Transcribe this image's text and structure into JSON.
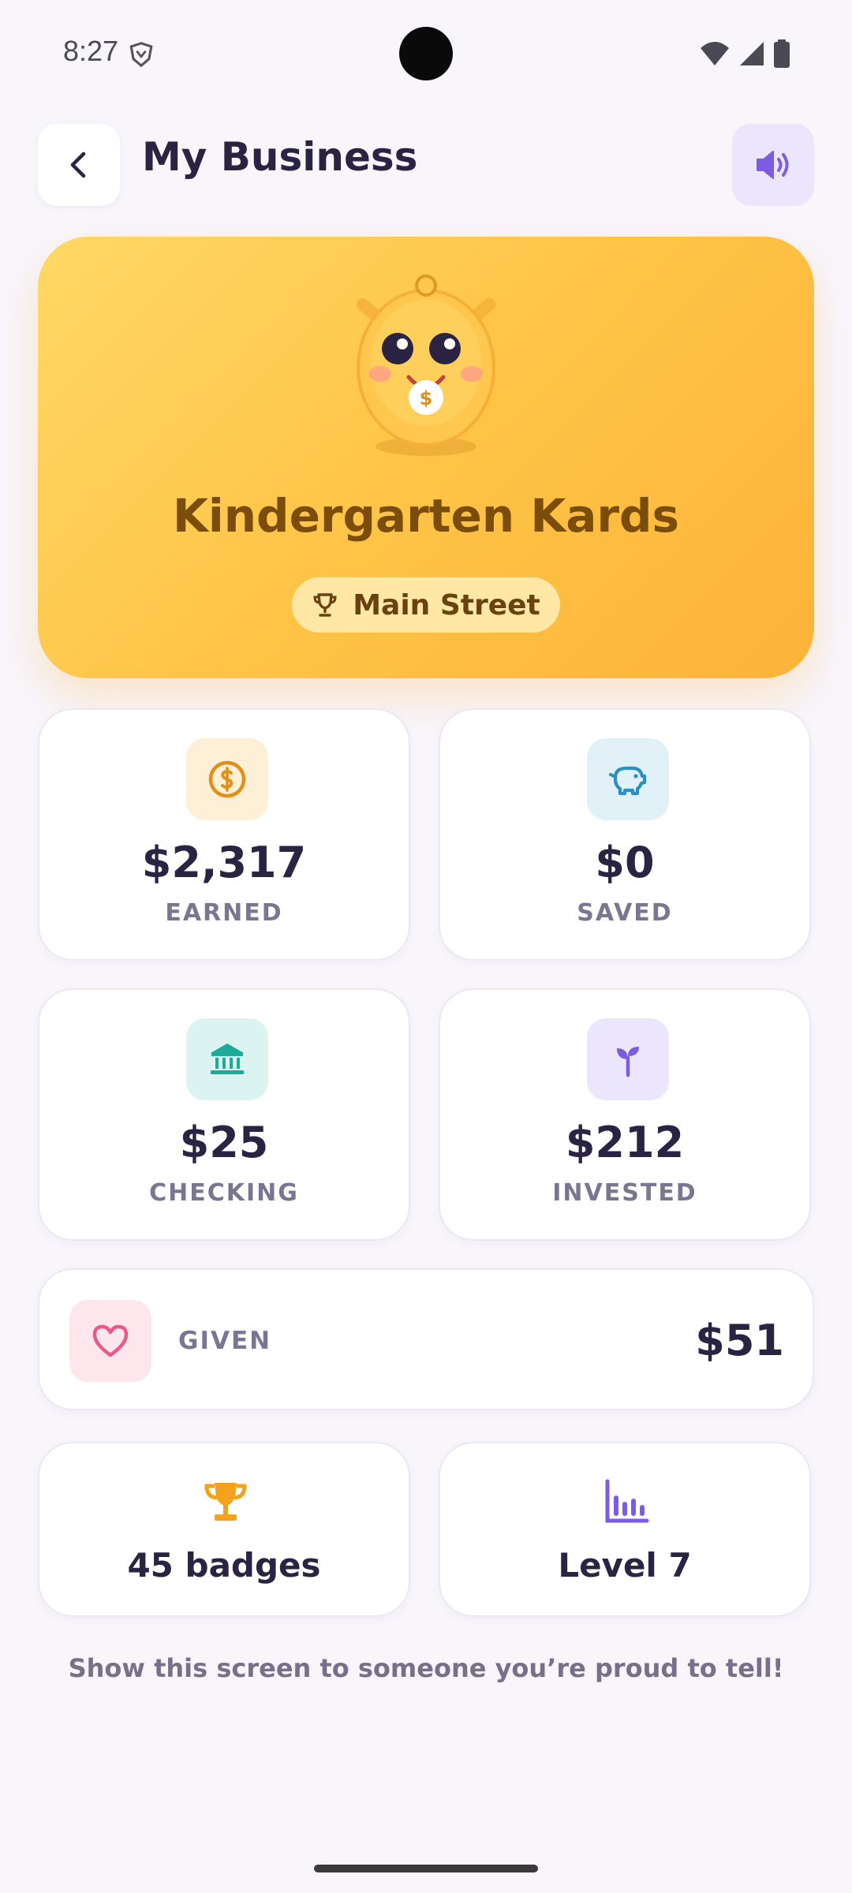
{
  "status_bar": {
    "time": "8:27"
  },
  "header": {
    "title": "My Business",
    "back_icon": "chevron-left-icon",
    "sound_icon": "speaker-icon"
  },
  "hero": {
    "business_name": "Kindergarten Kards",
    "street": "Main Street",
    "mascot_coin_symbol": "$",
    "colors": {
      "gradient_start": "#ffd865",
      "gradient_end": "#fcb338",
      "name_color": "#7a4d0a"
    }
  },
  "stats": [
    {
      "value": "$2,317",
      "label": "EARNED",
      "icon": "coin-icon",
      "icon_bg": "#fdf0d6",
      "icon_color": "#e0901a"
    },
    {
      "value": "$0",
      "label": "SAVED",
      "icon": "piggy-bank-icon",
      "icon_bg": "#e2f0f7",
      "icon_color": "#2b8fc2"
    },
    {
      "value": "$25",
      "label": "CHECKING",
      "icon": "bank-icon",
      "icon_bg": "#dcf4f1",
      "icon_color": "#1bab98"
    },
    {
      "value": "$212",
      "label": "INVESTED",
      "icon": "sprout-icon",
      "icon_bg": "#ece6fd",
      "icon_color": "#7c5ce0"
    }
  ],
  "given": {
    "label": "GIVEN",
    "value": "$51",
    "icon": "heart-icon",
    "icon_color": "#e95b87"
  },
  "badges": {
    "text": "45 badges",
    "icon": "trophy-icon"
  },
  "level": {
    "text": "Level 7",
    "icon": "bar-chart-icon"
  },
  "footer": {
    "message": "Show this screen to someone you’re proud to tell!"
  }
}
